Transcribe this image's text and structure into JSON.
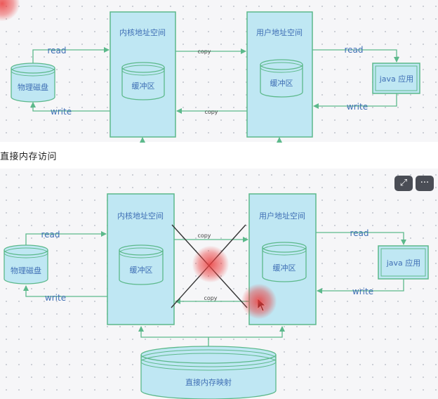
{
  "caption": "直接内存访问",
  "top": {
    "disk_label": "物理磁盘",
    "kernel_title": "内核地址空间",
    "kernel_buffer": "缓冲区",
    "user_title": "用户地址空间",
    "user_buffer": "缓冲区",
    "app_label": "java 应用",
    "read_left": "read",
    "write_left": "write",
    "read_right": "read",
    "write_right": "write",
    "copy_upper": "copy",
    "copy_lower": "copy"
  },
  "bottom": {
    "disk_label": "物理磁盘",
    "kernel_title": "内核地址空间",
    "kernel_buffer": "缓冲区",
    "user_title": "用户地址空间",
    "user_buffer": "缓冲区",
    "app_label": "java 应用",
    "read_left": "read",
    "write_left": "write",
    "read_right": "read",
    "write_right": "write",
    "copy_upper": "copy",
    "copy_lower": "copy",
    "mmap_label": "直接内存映射"
  },
  "toolbar": {
    "expand_icon": "expand-icon",
    "more_label": "···"
  },
  "colors": {
    "box_fill": "#bfe7f3",
    "box_stroke": "#5cb98b",
    "label": "#3f6fb5",
    "cross": "#333333",
    "highlight": "#e83c3c"
  }
}
